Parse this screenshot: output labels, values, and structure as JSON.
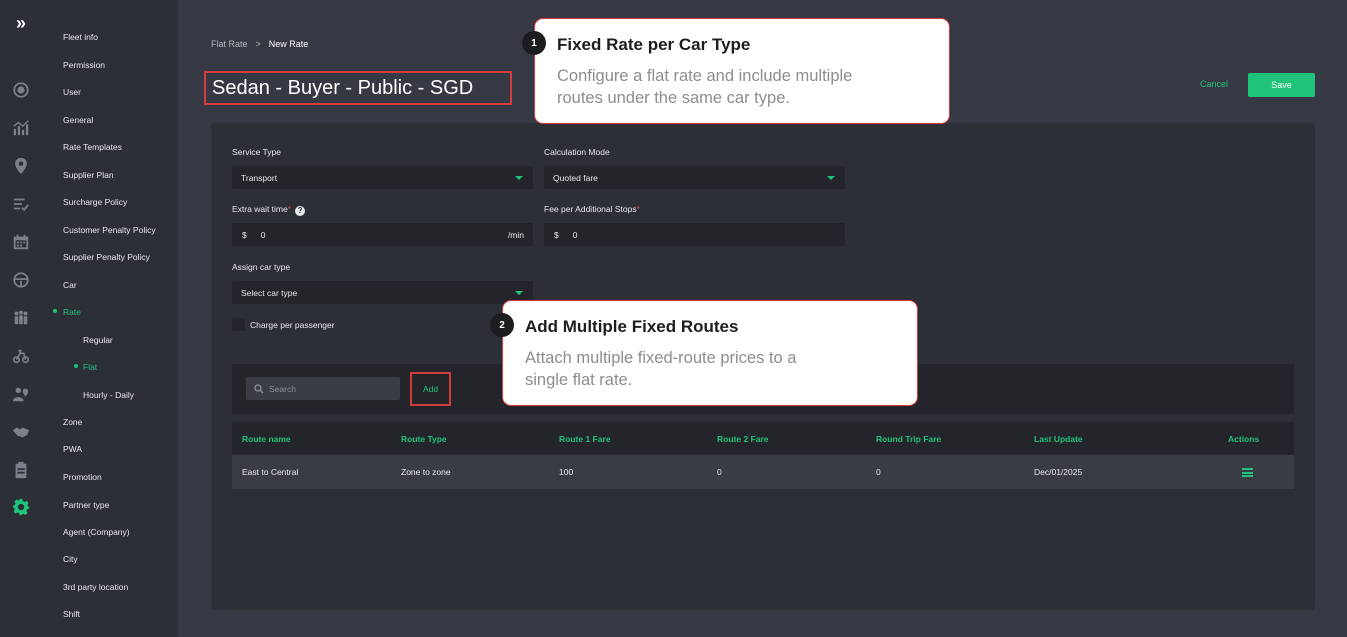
{
  "breadcrumb": {
    "parent": "Flat Rate",
    "separator": ">",
    "current": "New Rate"
  },
  "page_title": "Sedan - Buyer - Public - SGD",
  "actions": {
    "cancel": "Cancel",
    "save": "Save"
  },
  "nav": {
    "items": [
      "Fleet info",
      "Permission",
      "User",
      "General",
      "Rate Templates",
      "Supplier Plan",
      "Surcharge Policy",
      "Customer Penalty Policy",
      "Supplier Penalty Policy",
      "Car",
      "Rate",
      "Regular",
      "Flat",
      "Hourly - Daily",
      "Zone",
      "PWA",
      "Promotion",
      "Partner type",
      "Agent (Company)",
      "City",
      "3rd party location",
      "Shift"
    ]
  },
  "form": {
    "service_type": {
      "label": "Service Type",
      "value": "Transport"
    },
    "calculation_mode": {
      "label": "Calculation Mode",
      "value": "Quoted fare"
    },
    "extra_wait": {
      "label": "Extra wait time",
      "required": "*",
      "currency": "$",
      "value": "0",
      "unit": "/min"
    },
    "fee_stops": {
      "label": "Fee per Additional Stops",
      "required": "*",
      "currency": "$",
      "value": "0"
    },
    "assign_car": {
      "label": "Assign car type",
      "value": "Select car type"
    },
    "charge_per_passenger": "Charge per passenger"
  },
  "search": {
    "placeholder": "Search"
  },
  "add_label": "Add",
  "table": {
    "headers": [
      "Route name",
      "Route Type",
      "Route 1 Fare",
      "Route 2 Fare",
      "Round Trip Fare",
      "Last Update",
      "Actions"
    ],
    "rows": [
      [
        "East to Central",
        "Zone to zone",
        "100",
        "0",
        "0",
        "Dec/01/2025"
      ]
    ]
  },
  "callouts": [
    {
      "number": "1",
      "title": "Fixed Rate per Car Type",
      "line1": "Configure a flat rate and include multiple",
      "line2": "routes under the same car type."
    },
    {
      "number": "2",
      "title": "Add Multiple Fixed Routes",
      "line1": "Attach multiple fixed-route prices to a",
      "line2": "single flat rate."
    }
  ],
  "colors": {
    "accent": "#1fc37a",
    "highlight": "#d63a3a",
    "sidebar": "#2c2f36",
    "background": "#363943"
  },
  "icons": [
    "expand-icon",
    "target-icon",
    "analytics-icon",
    "map-pin-icon",
    "checklist-icon",
    "calendar-icon",
    "steering-wheel-icon",
    "group-icon",
    "delivery-icon",
    "users-location-icon",
    "handshake-icon",
    "clipboard-icon",
    "settings-gear-icon"
  ]
}
